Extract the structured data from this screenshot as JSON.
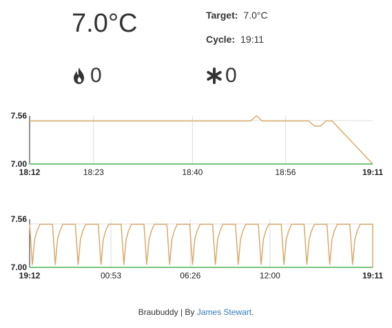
{
  "current_temp": "7.0°C",
  "target": {
    "label": "Target:",
    "value": "7.0°C"
  },
  "cycle": {
    "label": "Cycle:",
    "value": "19:11"
  },
  "heater": {
    "icon": "flame-icon",
    "count": "0"
  },
  "cooler": {
    "icon": "snowflake-icon",
    "count": "0"
  },
  "colors": {
    "temp_line": "#d9a96a",
    "target_line": "#4caf50",
    "grid": "#dddddd",
    "link": "#337ab7"
  },
  "chart_data": [
    {
      "type": "line",
      "ylim": [
        7.0,
        7.56
      ],
      "yticks": [
        "7.56",
        "7.00"
      ],
      "xticks": [
        "18:12",
        "18:23",
        "18:40",
        "18:56",
        "19:11"
      ],
      "grid": true,
      "series": [
        {
          "x": [
            "18:12",
            "18:50",
            "18:51",
            "18:52",
            "19:00",
            "19:01",
            "19:02",
            "19:03",
            "19:04",
            "19:11"
          ],
          "y": [
            7.5,
            7.5,
            7.56,
            7.5,
            7.5,
            7.44,
            7.44,
            7.5,
            7.5,
            7.0
          ]
        },
        {
          "x": [
            "18:12",
            "19:11"
          ],
          "y": [
            7.0,
            7.0
          ]
        }
      ]
    },
    {
      "type": "line",
      "ylim": [
        7.0,
        7.56
      ],
      "yticks": [
        "7.56",
        "7.00"
      ],
      "xticks": [
        "19:12",
        "00:53",
        "06:26",
        "12:00",
        "19:11"
      ],
      "grid": true,
      "series": [
        {
          "pattern": "sawtooth",
          "cycles": 15,
          "high": 7.5,
          "low": 7.03
        },
        {
          "x": [
            "19:12",
            "19:11"
          ],
          "y": [
            7.0,
            7.0
          ]
        }
      ]
    }
  ],
  "footer": {
    "brand": "Braubuddy",
    "sep": " | By ",
    "author": "James Stewart",
    "end": "."
  }
}
